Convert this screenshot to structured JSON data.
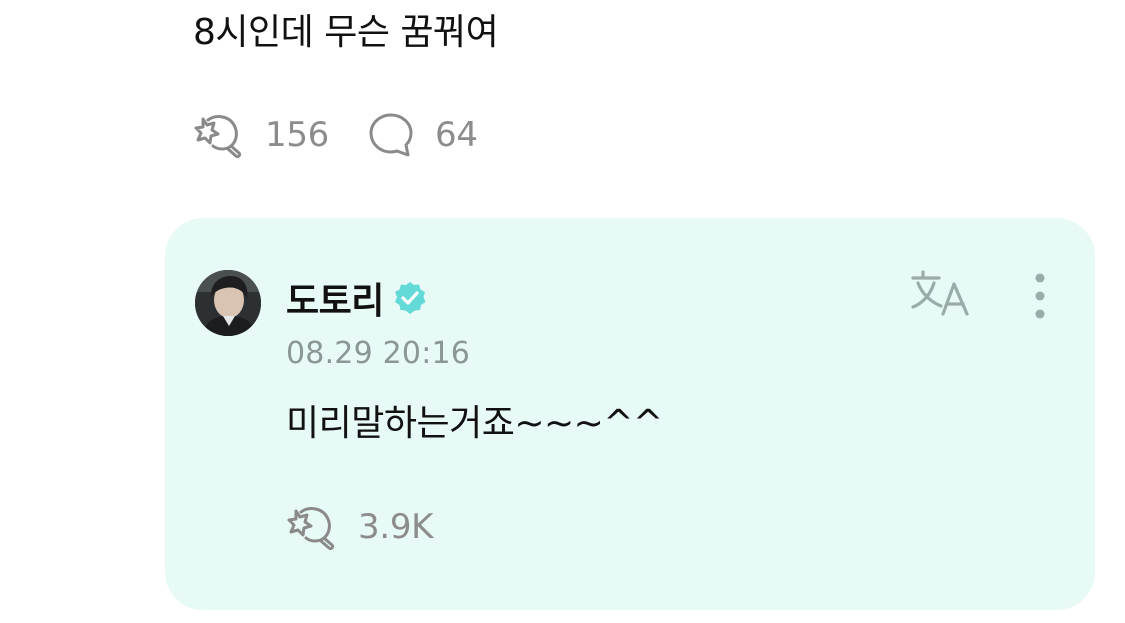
{
  "post": {
    "text": "8시인데 무슨 꿈꿔여",
    "actions": {
      "likes": "156",
      "comments": "64"
    }
  },
  "comment": {
    "author": "도토리",
    "verified": true,
    "timestamp": "08.29 20:16",
    "text": "미리말하는거죠~~~^^",
    "likes": "3.9K",
    "background": "#e8faf6",
    "badge_color": "#63dad8",
    "translate_icon": "translate-icon",
    "more_icon": "more-vertical-icon"
  },
  "colors": {
    "muted": "#8c8c8c",
    "icon": "#8a8a8a",
    "icon_on_card": "#9aaca8"
  }
}
